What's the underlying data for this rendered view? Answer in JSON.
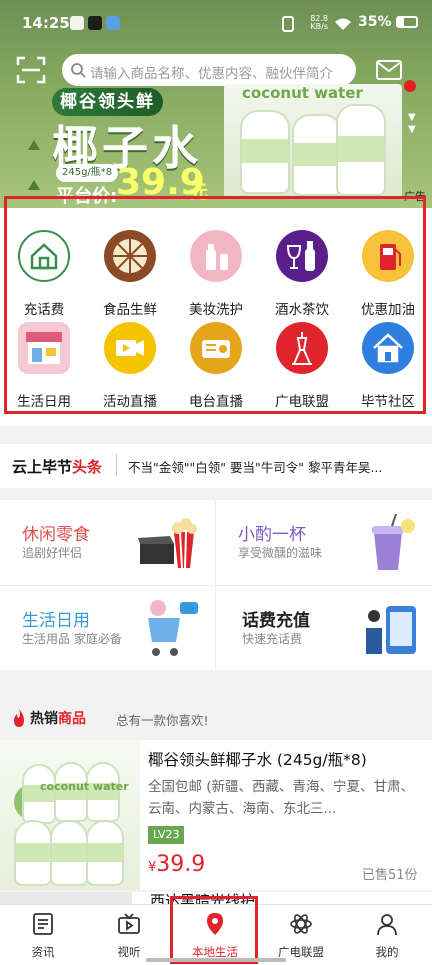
{
  "status_bar": {
    "time": "14:25",
    "net_speed_top": "82.8",
    "net_speed_unit": "KB/s",
    "battery": "35%"
  },
  "search": {
    "placeholder": "请输入商品名称、优惠内容、融伙伴简介"
  },
  "banner": {
    "brand": "椰谷领头鲜",
    "product": "椰子水",
    "spec": "245g/瓶*8",
    "platform_label": "平台价:",
    "price": "39.9",
    "unit": "元",
    "photo_text": "coconut water",
    "ad_label": "广告"
  },
  "services": [
    {
      "label": "充话费",
      "icon": "home-phone-icon",
      "color": "#ffffff"
    },
    {
      "label": "食品生鲜",
      "icon": "fruit-slice-icon",
      "color": "#8a4b26"
    },
    {
      "label": "美妆洗护",
      "icon": "cosmetics-icon",
      "color": "#f2b7c5"
    },
    {
      "label": "酒水茶饮",
      "icon": "wine-icon",
      "color": "#5b1f8c"
    },
    {
      "label": "优惠加油",
      "icon": "fuel-pump-icon",
      "color": "#f6c23a"
    },
    {
      "label": "生活日用",
      "icon": "shop-icon",
      "color": "#f5c8d2"
    },
    {
      "label": "活动直播",
      "icon": "video-camera-icon",
      "color": "#f5c400"
    },
    {
      "label": "电台直播",
      "icon": "radio-icon",
      "color": "#e5a51c"
    },
    {
      "label": "广电联盟",
      "icon": "tower-icon",
      "color": "#e0242b"
    },
    {
      "label": "毕节社区",
      "icon": "community-house-icon",
      "color": "#2f7fe0"
    }
  ],
  "headlines": {
    "brand_black": "云上毕节",
    "brand_red": "头条",
    "text": "不当\"金领\"\"白领\" 要当\"牛司令\" 黎平青年吴..."
  },
  "promos": [
    {
      "title": "休闲零食",
      "subtitle": "追剧好伴侣",
      "color": "#e0504f"
    },
    {
      "title": "小酌一杯",
      "subtitle": "享受微醺的滋味",
      "color": "#7a5cc0"
    },
    {
      "title": "生活日用",
      "subtitle": "生活用品 家庭必备",
      "color": "#3a9ad9"
    },
    {
      "title": "话费充值",
      "subtitle": "快速充话费",
      "color": "#222222"
    }
  ],
  "hot": {
    "title_black": "热销",
    "title_red": "商品",
    "subtitle": "总有一款你喜欢!"
  },
  "product": {
    "name": "椰谷领头鲜椰子水 (245g/瓶*8)",
    "desc": "全国包邮 (新疆、西藏、青海、宁夏、甘肃、云南、内蒙古、海南、东北三...",
    "level": "LV23",
    "currency": "¥",
    "price": "39.9",
    "sold": "已售51份",
    "image_text": "coconut water"
  },
  "product2": {
    "name": "西达黑暗光线护"
  },
  "tabs": [
    {
      "label": "资讯",
      "icon": "news-icon"
    },
    {
      "label": "视听",
      "icon": "tv-icon"
    },
    {
      "label": "本地生活",
      "icon": "location-pin-icon",
      "active": true
    },
    {
      "label": "广电联盟",
      "icon": "atom-icon"
    },
    {
      "label": "我的",
      "icon": "user-icon"
    }
  ],
  "colors": {
    "accent": "#e0242b",
    "banner_green": "#89ac61"
  }
}
